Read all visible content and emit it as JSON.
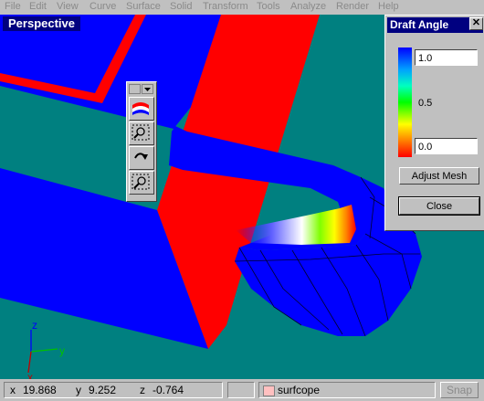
{
  "menu": [
    "File",
    "Edit",
    "View",
    "Curve",
    "Surface",
    "Solid",
    "Transform",
    "Tools",
    "Analyze",
    "Render",
    "Help"
  ],
  "viewport": {
    "title": "Perspective",
    "background": "#008080",
    "axes": {
      "x": "x",
      "y": "y",
      "z": "z"
    }
  },
  "toolbox": {
    "icons": [
      "draft-angle-icon",
      "zoom-window-icon",
      "undo-view-icon",
      "zoom-extents-icon"
    ]
  },
  "draft_panel": {
    "title": "Draft Angle",
    "max_value": "1.0",
    "mid_label": "0.5",
    "min_value": "0.0",
    "adjust_button": "Adjust Mesh",
    "close_button": "Close"
  },
  "status": {
    "x_label": "x",
    "x_value": "19.868",
    "y_label": "y",
    "y_value": "9.252",
    "z_label": "z",
    "z_value": "-0.764",
    "layer": "surfcope",
    "snap": "Snap"
  },
  "colors": {
    "surface_blue": "#0000ff",
    "surface_red": "#ff0000",
    "title_bar": "#000080"
  }
}
